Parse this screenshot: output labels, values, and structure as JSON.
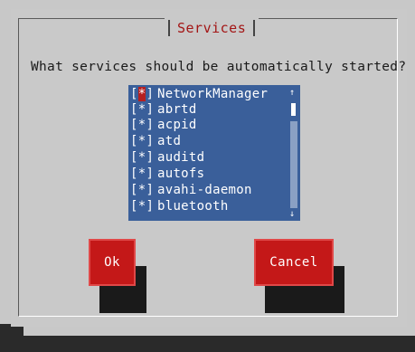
{
  "dialog": {
    "title": "Services",
    "question": "What services should be automatically started?",
    "ok_label": "Ok",
    "cancel_label": "Cancel"
  },
  "services": [
    {
      "name": "NetworkManager",
      "checked": true,
      "marker": "[*]"
    },
    {
      "name": "abrtd",
      "checked": true,
      "marker": "[*]"
    },
    {
      "name": "acpid",
      "checked": true,
      "marker": "[*]"
    },
    {
      "name": "atd",
      "checked": true,
      "marker": "[*]"
    },
    {
      "name": "auditd",
      "checked": true,
      "marker": "[*]"
    },
    {
      "name": "autofs",
      "checked": true,
      "marker": "[*]"
    },
    {
      "name": "avahi-daemon",
      "checked": true,
      "marker": "[*]"
    },
    {
      "name": "bluetooth",
      "checked": true,
      "marker": "[*]"
    }
  ],
  "scrollbar": {
    "up_icon": "arrow-up-icon",
    "down_icon": "arrow-down-icon",
    "up_glyph": "↑",
    "down_glyph": "↓"
  },
  "colors": {
    "title": "#a31515",
    "list_bg": "#3a5f9a",
    "button": "#c41818",
    "background": "#c9c9c9"
  }
}
